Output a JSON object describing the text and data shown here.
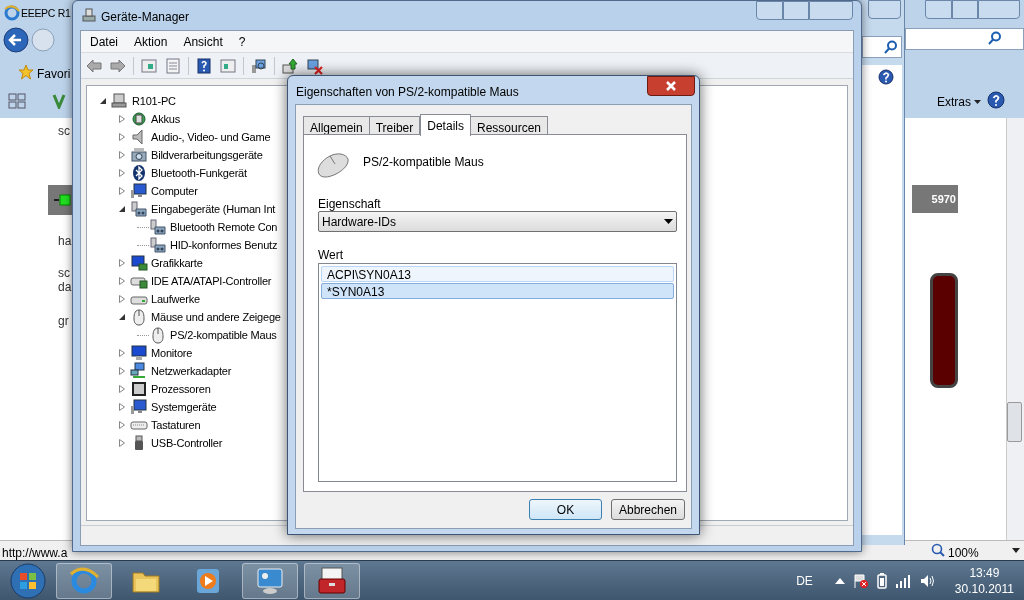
{
  "browser": {
    "title": "EEEPC R1",
    "favorites": "Favori",
    "extras": "Extras",
    "page_texts": [
      "sc",
      "ha",
      "sc",
      "da",
      "gr"
    ],
    "badge": "5970",
    "status_url": "http://www.a",
    "zoom": "100%"
  },
  "device_manager": {
    "title": "Geräte-Manager",
    "menu": [
      "Datei",
      "Aktion",
      "Ansicht",
      "?"
    ],
    "tree": {
      "label": "R101-PC",
      "kind": "host",
      "expanded": true,
      "children": [
        {
          "label": "Akkus",
          "kind": "battery",
          "expanded": false
        },
        {
          "label": "Audio-, Video- und Game",
          "kind": "audio",
          "expanded": false
        },
        {
          "label": "Bildverarbeitungsgeräte",
          "kind": "camera",
          "expanded": false
        },
        {
          "label": "Bluetooth-Funkgerät",
          "kind": "bluetooth",
          "expanded": false
        },
        {
          "label": "Computer",
          "kind": "computer",
          "expanded": false
        },
        {
          "label": "Eingabegeräte (Human Int",
          "kind": "hid",
          "expanded": true,
          "children": [
            {
              "label": "Bluetooth Remote Con",
              "kind": "hid"
            },
            {
              "label": "HID-konformes Benutz",
              "kind": "hid"
            }
          ]
        },
        {
          "label": "Grafikkarte",
          "kind": "display",
          "expanded": false
        },
        {
          "label": "IDE ATA/ATAPI-Controller",
          "kind": "ide",
          "expanded": false
        },
        {
          "label": "Laufwerke",
          "kind": "drive",
          "expanded": false
        },
        {
          "label": "Mäuse und andere Zeigege",
          "kind": "mouse",
          "expanded": true,
          "children": [
            {
              "label": "PS/2-kompatible Maus",
              "kind": "mouse"
            }
          ]
        },
        {
          "label": "Monitore",
          "kind": "monitor",
          "expanded": false
        },
        {
          "label": "Netzwerkadapter",
          "kind": "network",
          "expanded": false
        },
        {
          "label": "Prozessoren",
          "kind": "cpu",
          "expanded": false
        },
        {
          "label": "Systemgeräte",
          "kind": "computer",
          "expanded": false
        },
        {
          "label": "Tastaturen",
          "kind": "keyboard",
          "expanded": false
        },
        {
          "label": "USB-Controller",
          "kind": "usb",
          "expanded": false
        }
      ]
    }
  },
  "dialog": {
    "title": "Eigenschaften von PS/2-kompatible Maus",
    "tabs": [
      {
        "label": "Allgemein",
        "selected": false
      },
      {
        "label": "Treiber",
        "selected": false
      },
      {
        "label": "Details",
        "selected": true
      },
      {
        "label": "Ressourcen",
        "selected": false
      }
    ],
    "device_name": "PS/2-kompatible Maus",
    "property_label": "Eigenschaft",
    "property_value": "Hardware-IDs",
    "value_label": "Wert",
    "values": [
      {
        "text": "ACPI\\SYN0A13",
        "selected": false
      },
      {
        "text": "*SYN0A13",
        "selected": true
      }
    ],
    "buttons": [
      {
        "label": "OK",
        "default": true
      },
      {
        "label": "Abbrechen",
        "default": false
      }
    ]
  },
  "taskbar": {
    "apps": [
      {
        "kind": "browser",
        "running": true
      },
      {
        "kind": "folder",
        "running": false
      },
      {
        "kind": "media",
        "running": false
      },
      {
        "kind": "control",
        "running": true
      },
      {
        "kind": "toolbox",
        "running": true
      }
    ],
    "language": "DE",
    "time": "13:49",
    "date": "30.10.2011"
  }
}
